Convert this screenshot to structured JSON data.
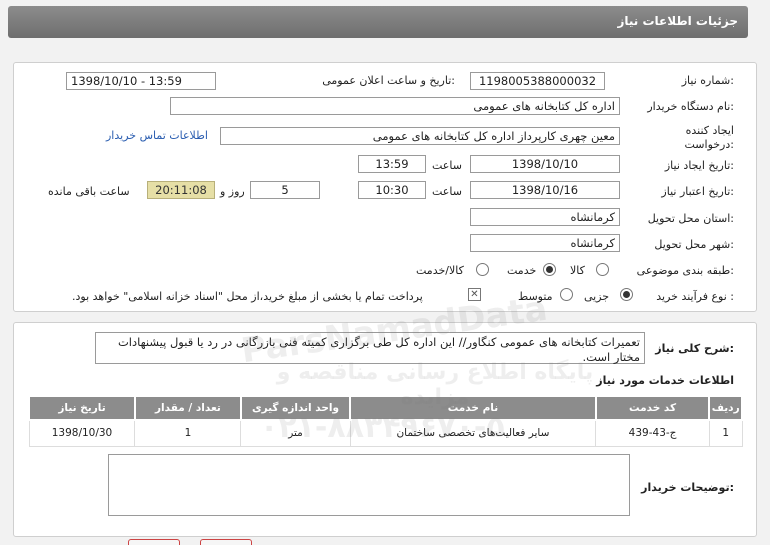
{
  "header": {
    "title": "جزئیات اطلاعات نیاز"
  },
  "form": {
    "need_number_label": "شماره نیاز:",
    "need_number": "1198005388000032",
    "announce_label": "تاریخ و ساعت اعلان عمومی:",
    "announce_value": "1398/10/10 - 13:59",
    "buyer_label": "نام دستگاه خریدار:",
    "buyer_value": "اداره کل کتابخانه های عمومی",
    "creator_label": "ایجاد کننده درخواست:",
    "creator_value": "معین چهری کارپرداز اداره کل کتابخانه های عمومی",
    "contact_link": "اطلاعات تماس خریدار",
    "created_date_label": "تاریخ ایجاد نیاز:",
    "created_date": "1398/10/10",
    "time_label": "ساعت",
    "created_time": "13:59",
    "validity_label": "تاریخ اعتبار نیاز:",
    "validity_date": "1398/10/16",
    "validity_time": "10:30",
    "days_value": "5",
    "days_label": "روز و",
    "remaining_timer": "20:11:08",
    "remaining_label": "ساعت باقی مانده",
    "province_label": "استان محل تحویل:",
    "province_value": "کرمانشاه",
    "city_label": "شهر محل تحویل:",
    "city_value": "کرمانشاه",
    "category_label": "طبقه بندی موضوعی:",
    "category_options": [
      "کالا",
      "خدمت",
      "کالا/خدمت"
    ],
    "category_selected": "خدمت",
    "process_label": "نوع فرآیند خرید :",
    "process_options": [
      "جزیی",
      "متوسط"
    ],
    "process_selected": "جزیی",
    "payment_note": "پرداخت تمام یا بخشی از مبلغ خرید،از محل \"اسناد خزانه اسلامی\" خواهد بود."
  },
  "details": {
    "summary_label": "شرح کلی نیاز:",
    "summary_text": "تعمیرات کتابخانه های عمومی کنگاور// این اداره کل طی برگزاری کمیته فنی بازرگانی در رد یا قبول پیشنهادات مختار است.",
    "services_title": "اطلاعات خدمات مورد نیاز",
    "table_headers": [
      "ردیف",
      "کد خدمت",
      "نام خدمت",
      "واحد اندازه گیری",
      "تعداد / مقدار",
      "تاریخ نیاز"
    ],
    "rows": [
      [
        "1",
        "ج-43-439",
        "سایر فعالیت‌های تخصصی ساختمان",
        "متر",
        "1",
        "1398/10/30"
      ]
    ],
    "buyer_notes_label": "توضیحات خریدار:",
    "buyer_notes_value": ""
  },
  "watermark": {
    "line1": "ParsNamadData",
    "line2": "پایگاه اطلاع رسانی مناقصه و مزایده",
    "line3": "۰۲۱-۸۸۳۴۹۶۷۰-۵"
  }
}
